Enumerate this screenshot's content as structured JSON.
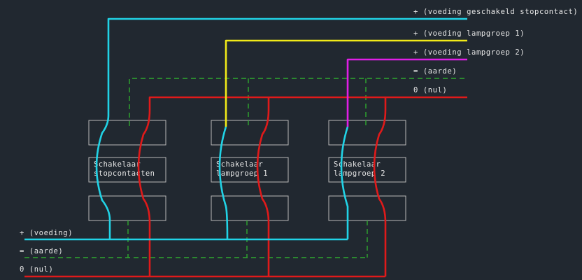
{
  "colors": {
    "background": "#212830",
    "voeding": "#21d3e6",
    "lampgroep1": "#f1ea18",
    "lampgroep2": "#e01ee6",
    "aarde": "#2fa82f",
    "nul": "#e01a1a",
    "box": "#b9b9b9",
    "text": "#e6e6e6"
  },
  "labels": {
    "right": {
      "voeding_stopcontact": "+ (voeding geschakeld stopcontact)",
      "voeding_lampgroep1": "+ (voeding lampgroep 1)",
      "voeding_lampgroep2": "+ (voeding lampgroep 2)",
      "aarde": "= (aarde)",
      "nul": "0 (nul)"
    },
    "left": {
      "voeding": "+ (voeding)",
      "aarde": "= (aarde)",
      "nul": "0 (nul)"
    }
  },
  "switches": [
    {
      "line1": "Schakelaar",
      "line2": "stopcontacten"
    },
    {
      "line1": "Schakelaar",
      "line2": "lampgroep 1"
    },
    {
      "line1": "Schakelaar",
      "line2": "lampgroep 2"
    }
  ]
}
